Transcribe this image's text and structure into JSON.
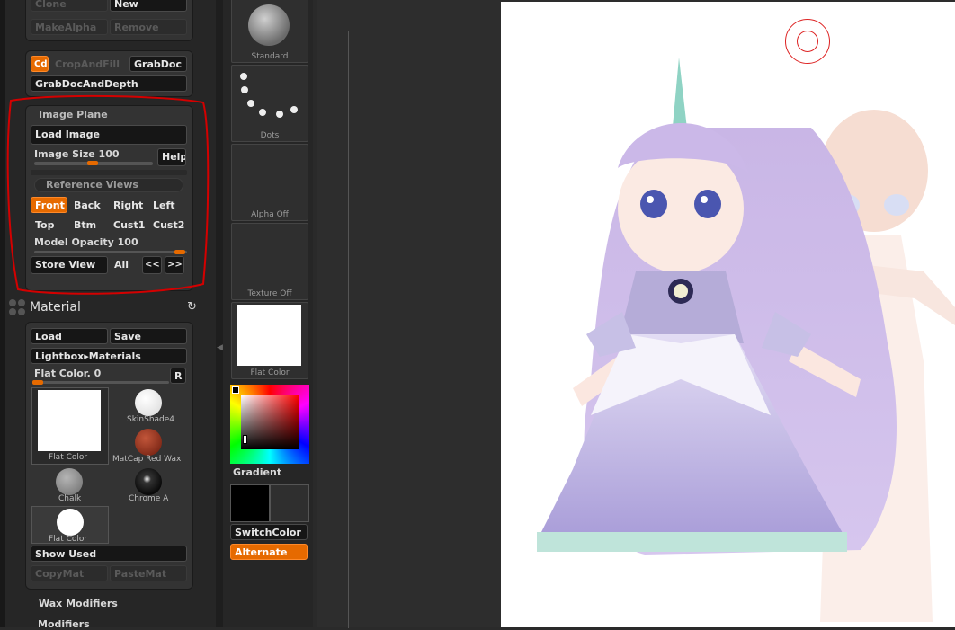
{
  "tools_panel": {
    "clone_label": "Clone",
    "new_label": "New",
    "makealpha_label": "MakeAlpha",
    "remove_label": "Remove",
    "cd_label": "Cd",
    "cropandfill_label": "CropAndFill",
    "grabdoc_label": "GrabDoc",
    "grabdocanddepth_label": "GrabDocAndDepth"
  },
  "image_plane": {
    "title": "Image Plane",
    "load_image_label": "Load Image",
    "image_size_label": "Image Size",
    "image_size_value": "100",
    "image_size_fraction": 0.5,
    "help_label": "Help",
    "reference_views_label": "Reference Views",
    "views": [
      "Front",
      "Back",
      "Right",
      "Left",
      "Top",
      "Btm",
      "Cust1",
      "Cust2"
    ],
    "active_view": "Front",
    "model_opacity_label": "Model Opacity",
    "model_opacity_value": "100",
    "model_opacity_fraction": 1.0,
    "store_view_label": "Store View",
    "all_label": "All",
    "prev_label": "<<",
    "next_label": ">>"
  },
  "material": {
    "title": "Material",
    "load_label": "Load",
    "save_label": "Save",
    "lightbox_label": "Lightbox▸Materials",
    "flat_color_label": "Flat Color.",
    "flat_color_value": "0",
    "flat_color_fraction": 0.0,
    "r_label": "R",
    "thumbs": [
      {
        "name": "Flat Color",
        "color": "#ffffff"
      },
      {
        "name": "SkinShade4",
        "color": "#f2f2f2"
      },
      {
        "name": "MatCap Red Wax",
        "color": "#8a2a14"
      },
      {
        "name": "Chalk",
        "color": "#9a9a9a"
      },
      {
        "name": "Chrome A",
        "color": "#1a1a1a"
      },
      {
        "name": "Flat Color",
        "color": "#ffffff"
      }
    ],
    "show_used_label": "Show Used",
    "copymat_label": "CopyMat",
    "pastemat_label": "PasteMat"
  },
  "subpalettes": {
    "wax_modifiers_label": "Wax Modifiers",
    "modifiers_label": "Modifiers"
  },
  "shelf": {
    "brush_label": "Standard",
    "stroke_label": "Dots",
    "alpha_label": "Alpha Off",
    "texture_label": "Texture Off",
    "material_label": "Flat Color",
    "gradient_label": "Gradient",
    "switchcolor_label": "SwitchColor",
    "alternate_label": "Alternate"
  },
  "colors": {
    "accent": "#e66a00",
    "highlight_ring": "#d40000"
  }
}
